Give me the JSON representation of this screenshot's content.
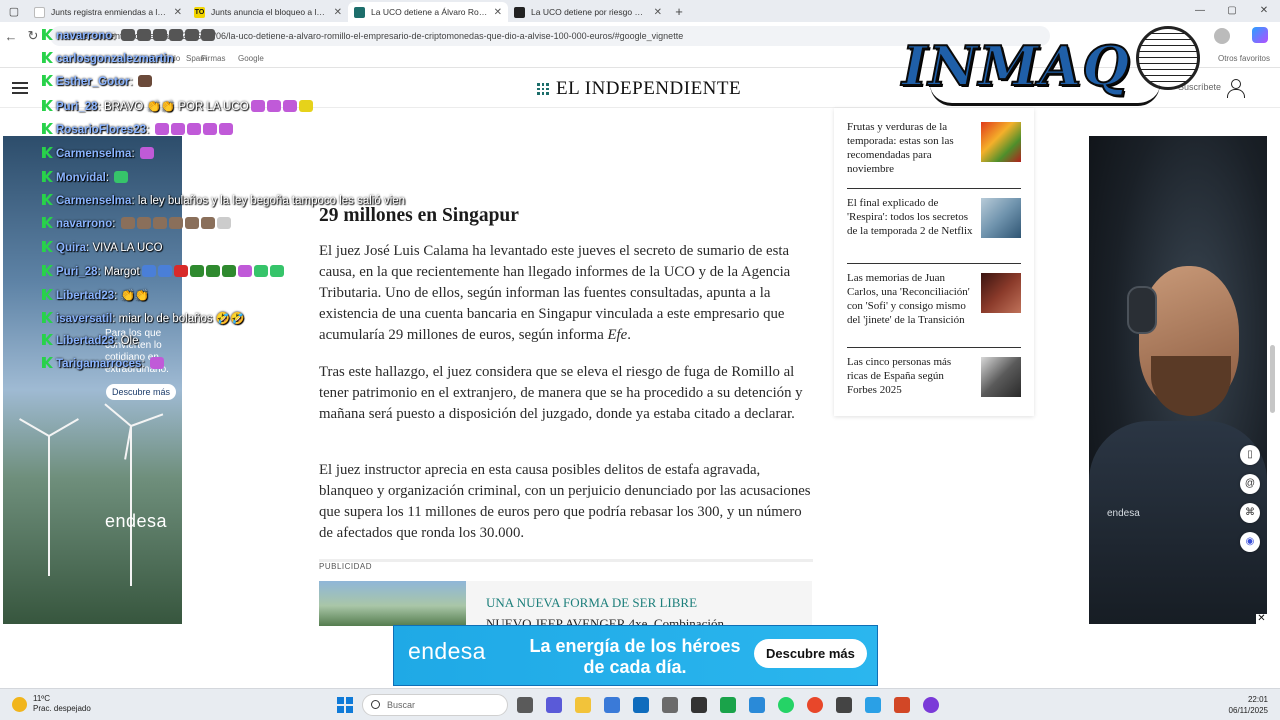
{
  "browser": {
    "tabs": [
      {
        "title": "Junts registra enmiendas a la tota",
        "favicon": "JS",
        "color": "#ffffff",
        "active": false
      },
      {
        "title": "Junts anuncia el bloqueo a la legi",
        "favicon": "TO",
        "color": "#f2d500",
        "active": false
      },
      {
        "title": "La UCO detiene a Álvaro Romillo",
        "favicon": "EI",
        "color": "#1d6e6b",
        "active": true
      },
      {
        "title": "La UCO detiene por riesgo de fug",
        "favicon": "EL",
        "color": "#222222",
        "active": false
      }
    ],
    "url": "elindependiente.com/espana/2025/11/06/la-uco-detiene-a-alvaro-romillo-el-empresario-de-criptomonedas-que-dio-a-alvise-100-000-euros/#google_vignette",
    "favorites": [
      "Eduardo",
      "Spam",
      "Firmas",
      "Google"
    ],
    "other_favorites": "Otros favoritos"
  },
  "site": {
    "logo": "EL INDEPENDIENTE",
    "subscribe": "Suscríbete"
  },
  "overlay_logo": {
    "text": "INMAQ"
  },
  "chat": [
    {
      "user": "navarrono",
      "text": "",
      "emotes": 6
    },
    {
      "user": "carlosgonzalezmartin",
      "text": "",
      "emotes": 0
    },
    {
      "user": "Esther_Gotor",
      "text": "",
      "emotes": 1
    },
    {
      "user": "Puri_28",
      "text": "BRAVO 👏👏 POR LA UCO",
      "emotes": 4
    },
    {
      "user": "RosarioFlores23",
      "text": "",
      "emotes": 5
    },
    {
      "user": "Carmenselma",
      "text": "",
      "emotes": 1
    },
    {
      "user": "Monvidal",
      "text": "",
      "emotes": 1
    },
    {
      "user": "Carmenselma",
      "text": "la ley bulaños y la ley begoña tampoco les salió vien",
      "emotes": 0
    },
    {
      "user": "navarrono",
      "text": "",
      "emotes": 7
    },
    {
      "user": "Quira",
      "text": "VIVA LA UCO",
      "emotes": 0
    },
    {
      "user": "Puri_28",
      "text": "Margot",
      "emotes": 9
    },
    {
      "user": "Libertad23",
      "text": "👏👏",
      "emotes": 0
    },
    {
      "user": "isaversatil",
      "text": "miar lo de bolaños 🤣🤣",
      "emotes": 0
    },
    {
      "user": "Libertad23",
      "text": "Ole",
      "emotes": 0
    },
    {
      "user": "Tarigamarroces",
      "text": "",
      "emotes": 1
    }
  ],
  "left_ad": {
    "text": "Para los que convierten lo cotidiano en extraordinario.",
    "button": "Descubre más",
    "brand": "endesa"
  },
  "right_ad": {
    "brand": "endesa"
  },
  "article": {
    "heading": "29 millones en Singapur",
    "p1": "El juez José Luis Calama ha levantado este jueves el secreto de sumario de esta causa, en la que recientemente han llegado informes de la UCO y de la Agencia Tributaria. Uno de ellos, según informan las fuentes consultadas, apunta a la existencia de una cuenta bancaria en Singapur vinculada a este empresario que acumularía 29 millones de euros, según informa ",
    "p1_source": "Efe",
    "p1_end": ".",
    "p2": "Tras este hallazgo, el juez considera que se eleva el riesgo de fuga de Romillo al tener patrimonio en el extranjero, de manera que se ha procedido a su detención y mañana será puesto a disposición del juzgado, donde ya estaba citado a declarar.",
    "p3": "El juez instructor aprecia en esta causa posibles delitos de estafa agravada, blanqueo y organización criminal, con un perjuicio denunciado por las acusaciones que supera los 11 millones de euros pero que podría rebasar los 300, y un número de afectados que ronda los 30.000.",
    "ad_label": "PUBLICIDAD",
    "promo_kicker": "UNA NUEVA FORMA DE SER LIBRE",
    "promo_title": "NUEVO JEEP AVENGER 4xe. Combinación"
  },
  "sidebar": [
    {
      "title": "Frutas y verduras de la temporada: estas son las recomendadas para noviembre",
      "thumb": "#d94a1c"
    },
    {
      "title": "El final explicado de 'Respira': todos los secretos de la temporada 2 de Netflix",
      "thumb": "#8fb0c7"
    },
    {
      "title": "Las memorias de Juan Carlos, una 'Reconciliación' con 'Sofi' y consigo mismo del 'jinete' de la Transición",
      "thumb": "#6b2a1f"
    },
    {
      "title": "Las cinco personas más ricas de España según Forbes 2025",
      "thumb": "#7a7a7a"
    }
  ],
  "banner": {
    "brand": "endesa",
    "text": "La energía de los héroes de cada día.",
    "button": "Descubre más"
  },
  "taskbar": {
    "temp": "11ºC",
    "weather": "Prac. despejado",
    "search": "Buscar",
    "time": "22:01",
    "date": "06/11/2025"
  }
}
